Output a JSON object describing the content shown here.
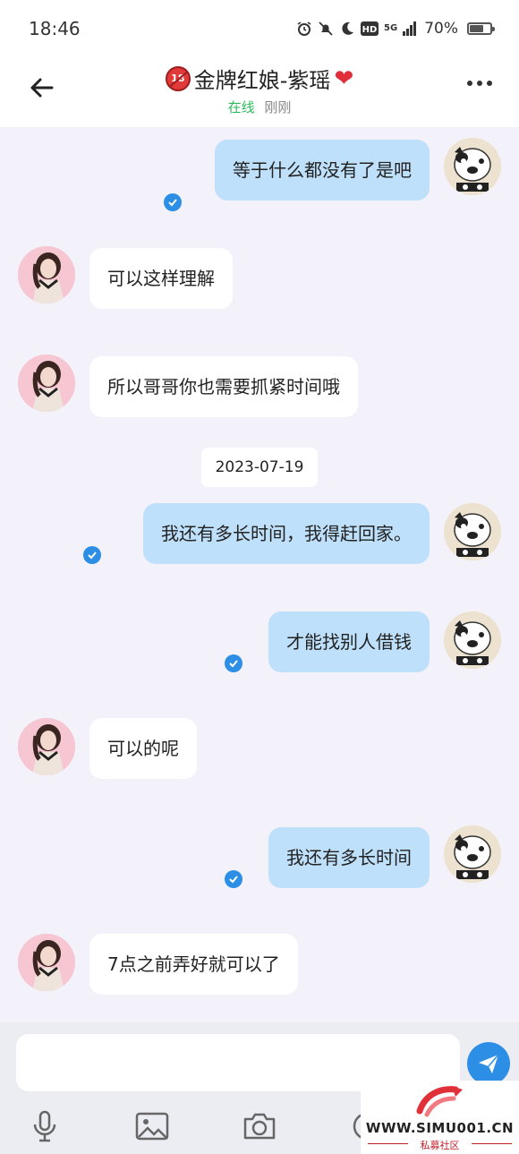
{
  "status_bar": {
    "time": "18:46",
    "network": "5G",
    "battery_percent": "70%",
    "battery_level": 0.7
  },
  "header": {
    "title": "金牌红娘-紫瑶",
    "online_label": "在线",
    "last_seen": "刚刚"
  },
  "messages": [
    {
      "side": "me",
      "text": "等于什么都没有了是吧",
      "read": true
    },
    {
      "side": "her",
      "text": "可以这样理解"
    },
    {
      "side": "her",
      "text": "所以哥哥你也需要抓紧时间哦"
    },
    {
      "side": "me",
      "text": "我还有多长时间，我得赶回家。",
      "read": true
    },
    {
      "side": "me",
      "text": "才能找别人借钱",
      "read": true
    },
    {
      "side": "her",
      "text": "可以的呢"
    },
    {
      "side": "me",
      "text": "我还有多长时间",
      "read": true
    },
    {
      "side": "her",
      "text": "7点之前弄好就可以了"
    }
  ],
  "date_divider": "2023-07-19",
  "composer": {
    "value": "",
    "placeholder": ""
  },
  "toolbar": {
    "icons": [
      "mic-icon",
      "image-icon",
      "camera-icon",
      "emoji-icon"
    ]
  },
  "watermark": {
    "site": "WWW.SIMU001.CN",
    "name": "私募社区"
  },
  "colors": {
    "my_bubble": "#bfe0fb",
    "her_bubble": "#ffffff",
    "accent": "#2d8ee6",
    "online": "#2db95a",
    "background": "#f3f2fa"
  }
}
